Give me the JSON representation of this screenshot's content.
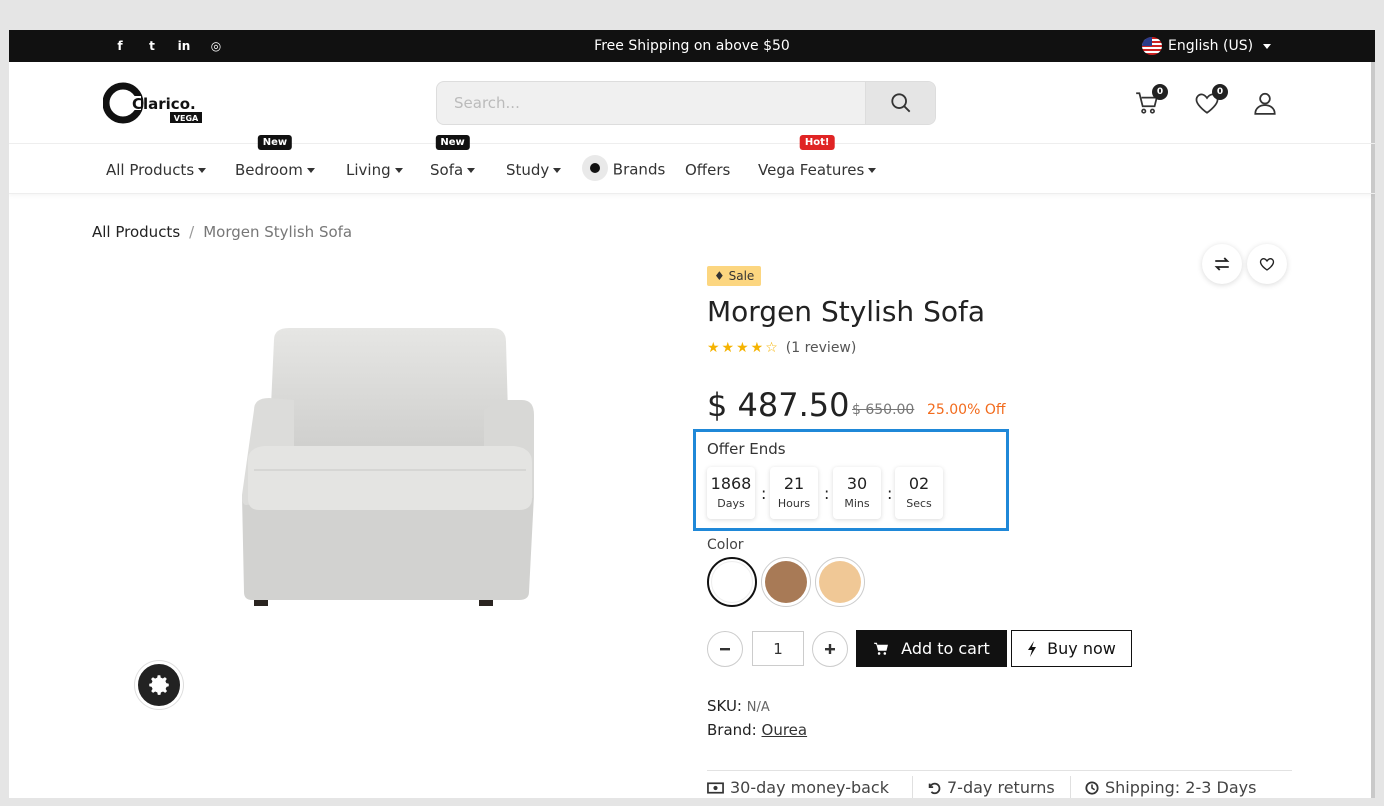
{
  "topbar": {
    "social_icons": [
      "facebook-icon",
      "twitter-icon",
      "linkedin-icon",
      "instagram-icon"
    ],
    "social_glyphs": [
      "f",
      "t",
      "in",
      "◎"
    ],
    "promo": "Free Shipping on above $50",
    "language": "English (US)"
  },
  "header": {
    "logo_text": "Clarico.",
    "logo_sub": "VEGA",
    "search_placeholder": "Search...",
    "cart_count": "0",
    "wishlist_count": "0"
  },
  "nav": {
    "items": [
      {
        "label": "All Products",
        "badge": ""
      },
      {
        "label": "Bedroom",
        "badge": "New"
      },
      {
        "label": "Living",
        "badge": ""
      },
      {
        "label": "Sofa",
        "badge": "New"
      },
      {
        "label": "Study",
        "badge": ""
      },
      {
        "label": "Brands",
        "badge": ""
      },
      {
        "label": "Offers",
        "badge": ""
      },
      {
        "label": "Vega Features",
        "badge": "Hot!"
      }
    ]
  },
  "breadcrumb": {
    "parent": "All Products",
    "separator": "/",
    "current": "Morgen Stylish Sofa"
  },
  "product": {
    "sale_label": "Sale",
    "title": "Morgen Stylish Sofa",
    "rating": 4,
    "rating_max": 5,
    "review_text": "(1 review)",
    "price": "$ 487.50",
    "old_price": "$ 650.00",
    "discount": "25.00% Off",
    "offer_label": "Offer Ends",
    "countdown": [
      {
        "value": "1868",
        "label": "Days"
      },
      {
        "value": "21",
        "label": "Hours"
      },
      {
        "value": "30",
        "label": "Mins"
      },
      {
        "value": "02",
        "label": "Secs"
      }
    ],
    "color_label": "Color",
    "colors": [
      "#ffffff",
      "#a87a56",
      "#f0c896"
    ],
    "quantity": "1",
    "add_to_cart": "Add to cart",
    "buy_now": "Buy now",
    "sku_label": "SKU:",
    "sku_value": "N/A",
    "brand_label": "Brand:",
    "brand_value": "Ourea",
    "features": [
      "30-day money-back",
      "7-day returns",
      "Shipping: 2-3 Days"
    ]
  },
  "colors": {
    "accent_blue": "#1f88d8",
    "sale_yellow": "#fcd680",
    "discount_orange": "#f26b1d",
    "hot_red": "#e02424",
    "star_gold": "#f5b301"
  }
}
